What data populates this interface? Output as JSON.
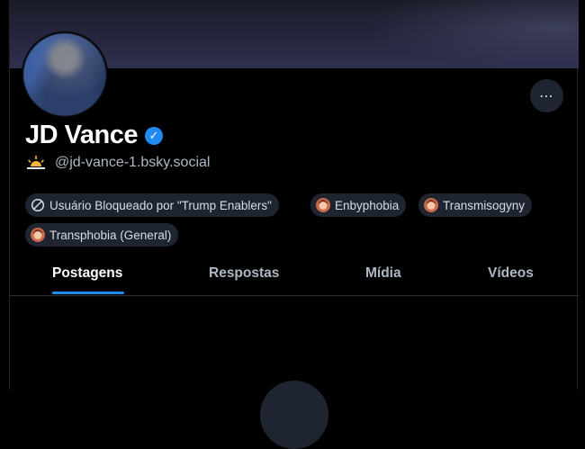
{
  "profile": {
    "display_name": "JD Vance",
    "handle": "@jd-vance-1.bsky.social",
    "verified_glyph": "✓",
    "avatar_icon": "avatar-blurred"
  },
  "header": {
    "more_glyph": "⋯"
  },
  "labels": [
    {
      "text": "Usuário Bloqueado por \"Trump Enablers\"",
      "icon": "blocked-icon"
    },
    {
      "text": "Enbyphobia",
      "icon": "labeler-avatar-icon"
    },
    {
      "text": "Transmisogyny",
      "icon": "labeler-avatar-icon"
    },
    {
      "text": "Transphobia (General)",
      "icon": "labeler-avatar-icon"
    }
  ],
  "tabs": [
    {
      "label": "Postagens",
      "active": true
    },
    {
      "label": "Respostas",
      "active": false
    },
    {
      "label": "Mídia",
      "active": false
    },
    {
      "label": "Vídeos",
      "active": false
    }
  ],
  "colors": {
    "background": "#000000",
    "accent": "#1f8bf0",
    "pill_bg": "#1e2530",
    "muted_text": "#aeb8c4"
  }
}
